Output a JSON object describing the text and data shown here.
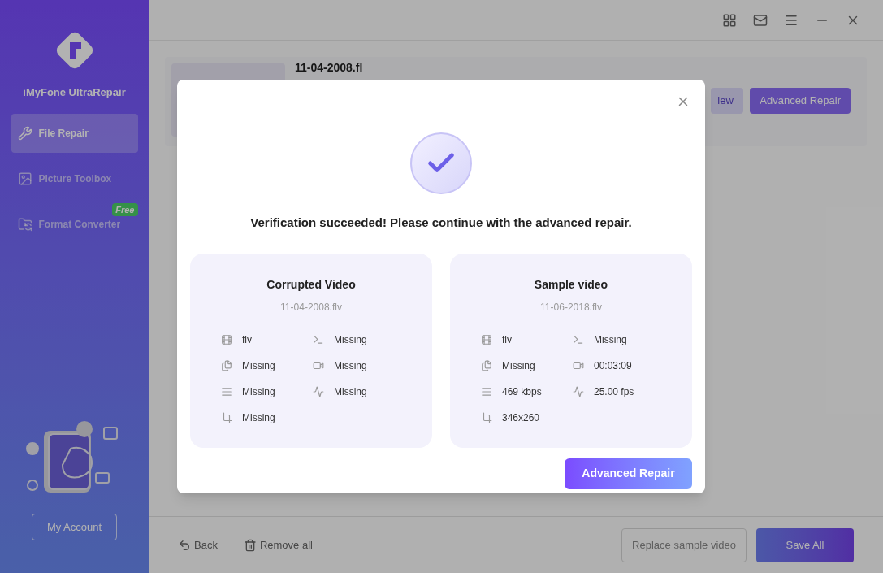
{
  "app": {
    "name": "iMyFone UltraRepair"
  },
  "sidebar": {
    "items": [
      {
        "label": "File Repair",
        "kind": "repair",
        "selected": true
      },
      {
        "label": "Picture Toolbox",
        "kind": "picture",
        "selected": false
      },
      {
        "label": "Format Converter",
        "kind": "convert",
        "selected": false,
        "badge": "Free"
      }
    ],
    "account_button": "My Account"
  },
  "file_row": {
    "title": "11-04-2008.fl",
    "buttons": [
      "iew",
      "Advanced Repair"
    ]
  },
  "dialog": {
    "message": "Verification succeeded! Please continue with the advanced repair.",
    "cards": [
      {
        "title": "Corrupted Video",
        "file": "11-04-2008.flv",
        "fields": [
          {
            "kind": "format",
            "value": "flv"
          },
          {
            "kind": "subtitle",
            "value": "Missing"
          },
          {
            "kind": "size",
            "value": "Missing"
          },
          {
            "kind": "duration",
            "value": "Missing"
          },
          {
            "kind": "bitrate",
            "value": "Missing"
          },
          {
            "kind": "framerate",
            "value": "Missing"
          },
          {
            "kind": "resolution",
            "value": "Missing"
          }
        ]
      },
      {
        "title": "Sample video",
        "file": "11-06-2018.flv",
        "fields": [
          {
            "kind": "format",
            "value": "flv"
          },
          {
            "kind": "subtitle",
            "value": "Missing"
          },
          {
            "kind": "size",
            "value": "Missing"
          },
          {
            "kind": "duration",
            "value": "00:03:09"
          },
          {
            "kind": "bitrate",
            "value": "469 kbps"
          },
          {
            "kind": "framerate",
            "value": "25.00 fps"
          },
          {
            "kind": "resolution",
            "value": "346x260"
          }
        ]
      }
    ],
    "button": "Advanced Repair"
  },
  "bottom_bar": {
    "back": "Back",
    "remove": "Remove all",
    "replace": "Replace sample video",
    "save": "Save All"
  }
}
